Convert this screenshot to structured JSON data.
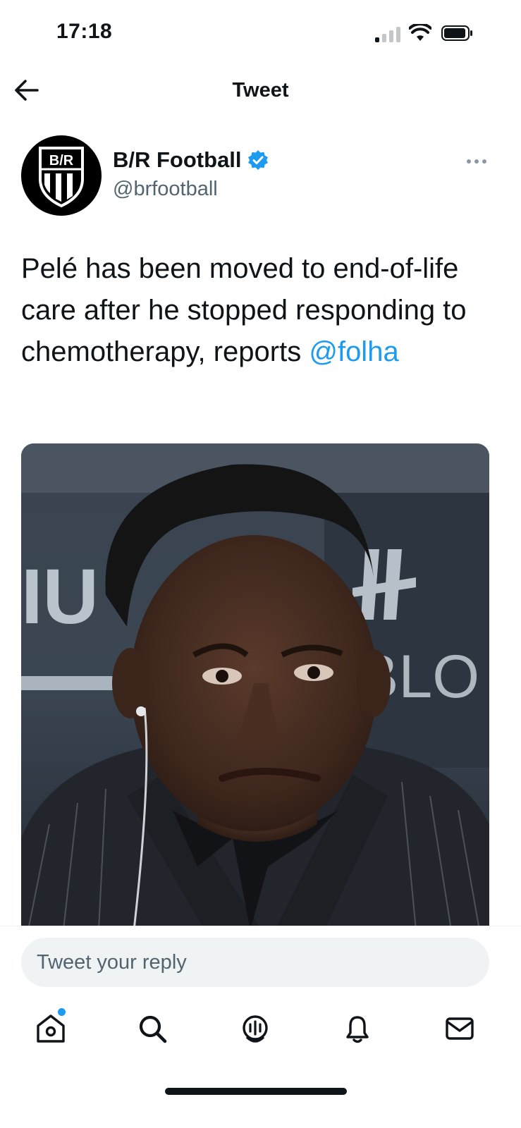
{
  "status_bar": {
    "time": "17:18"
  },
  "header": {
    "title": "Tweet"
  },
  "author": {
    "name": "B/R Football",
    "handle": "@brfootball",
    "avatar_text": "B/R"
  },
  "tweet": {
    "text": "Pelé has been moved to end-of-life care after he stopped responding to chemotherapy, reports ",
    "mention": "@folha"
  },
  "photo": {
    "backdrop_text_left": "IU",
    "backdrop_text_right": "BLO"
  },
  "reply": {
    "placeholder": "Tweet your reply"
  },
  "tabs": [
    {
      "icon": "home-icon",
      "has_notification_dot": true
    },
    {
      "icon": "search-icon"
    },
    {
      "icon": "spaces-icon"
    },
    {
      "icon": "bell-icon"
    },
    {
      "icon": "mail-icon"
    }
  ],
  "colors": {
    "accent": "#1d9bf0",
    "text": "#0f1419",
    "secondary": "#536471"
  }
}
